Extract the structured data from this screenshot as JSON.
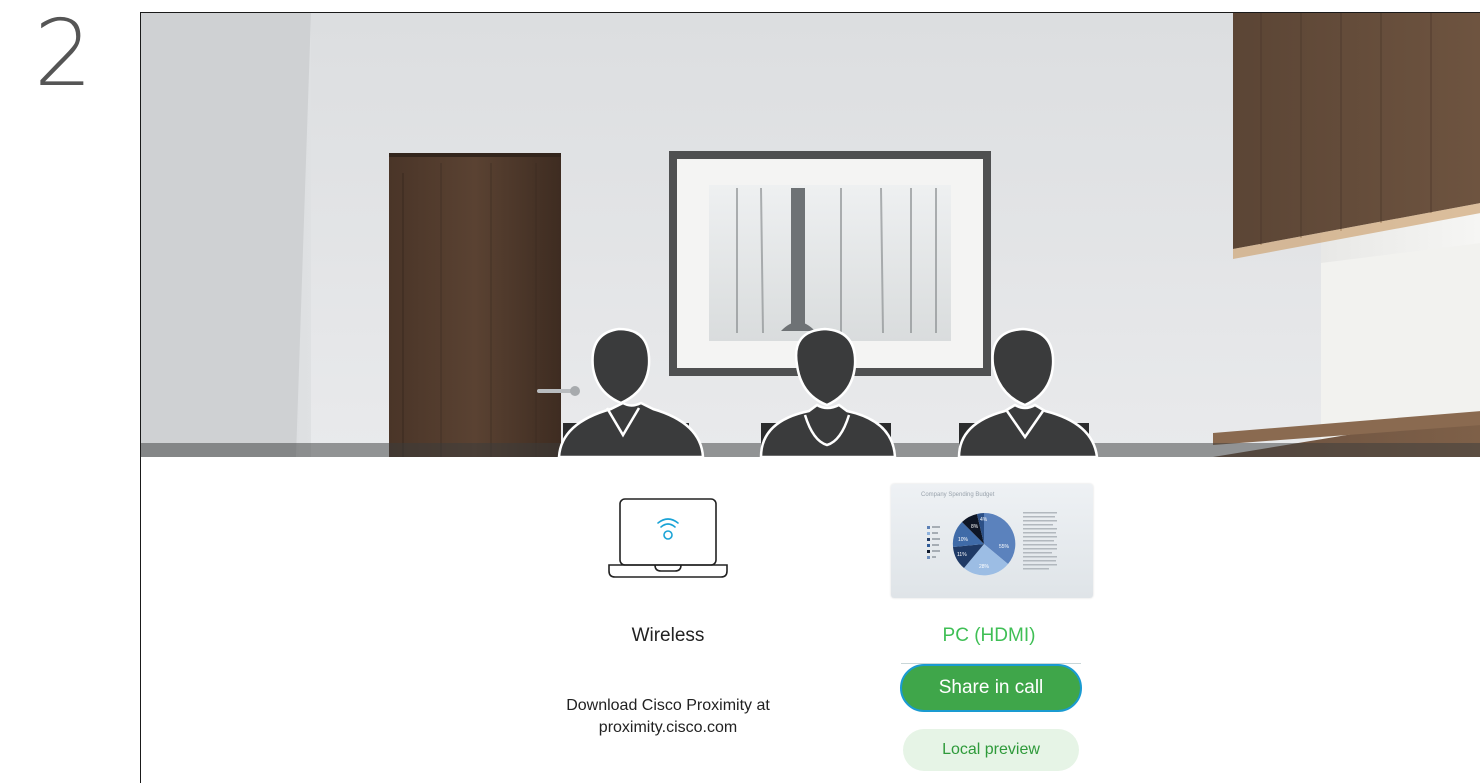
{
  "step": {
    "number": "2"
  },
  "sources": {
    "wireless": {
      "icon": "laptop-wireless-icon",
      "label": "Wireless",
      "hint_line1": "Download Cisco Proximity at",
      "hint_line2": "proximity.cisco.com"
    },
    "pc": {
      "label": "PC (HDMI)",
      "thumbnail": {
        "title": "Company Spending Budget",
        "slices": [
          "55%",
          "28%",
          "11%",
          "10%",
          "8%",
          "4%"
        ]
      }
    }
  },
  "actions": {
    "share_label": "Share in call",
    "preview_label": "Local preview"
  },
  "colors": {
    "accent_green": "#3fa64a",
    "focus_blue": "#1a9bd1",
    "label_green": "#3fbf55",
    "preview_bg": "#e6f4e6"
  }
}
